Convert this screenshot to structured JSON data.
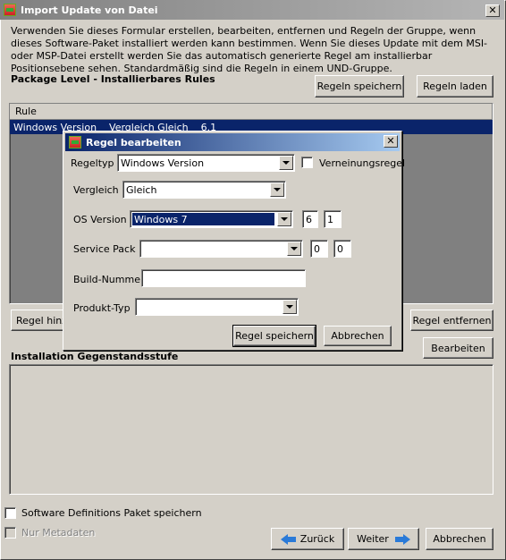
{
  "window": {
    "title": "Import Update von Datei",
    "close": "✕"
  },
  "description": "Verwenden Sie dieses Formular erstellen, bearbeiten, entfernen und Regeln der Gruppe, wenn dieses Software-Paket installiert werden kann bestimmen. Wenn Sie dieses Update mit dem MSI-oder MSP-Datei erstellt werden Sie das automatisch generierte Regel am installierbar Positionsebene sehen. Standardmäßig sind die Regeln in einem UND-Gruppe.",
  "package_level": {
    "heading": "Package Level - Installierbares Rules",
    "save_rules": "Regeln speichern",
    "load_rules": "Regeln laden",
    "list_header": "Rule",
    "selected_row": "Windows Version    Vergleich Gleich    6.1",
    "add_rule": "Regel hinzu",
    "remove_rule": "Regel entfernen",
    "edit": "Bearbeiten"
  },
  "installation_level": {
    "heading": "Installation Gegenstandsstufe"
  },
  "footer": {
    "save_sdp": "Software Definitions Paket speichern",
    "metadata_only": "Nur Metadaten",
    "back": "Zurück",
    "next": "Weiter",
    "cancel": "Abbrechen"
  },
  "dialog": {
    "title": "Regel bearbeiten",
    "close": "✕",
    "rule_type_label": "Regeltyp",
    "rule_type_value": "Windows Version",
    "negation_label": "Verneinungsregel",
    "compare_label": "Vergleich",
    "compare_value": "Gleich",
    "os_version_label": "OS Version",
    "os_version_value": "Windows 7",
    "os_major": "6",
    "os_minor": "1",
    "service_pack_label": "Service Pack",
    "service_pack_value": "",
    "sp_major": "0",
    "sp_minor": "0",
    "build_label": "Build-Nummer",
    "build_value": "",
    "product_type_label": "Produkt-Typ",
    "product_type_value": "",
    "save_rule": "Regel speichern",
    "cancel": "Abbrechen"
  }
}
